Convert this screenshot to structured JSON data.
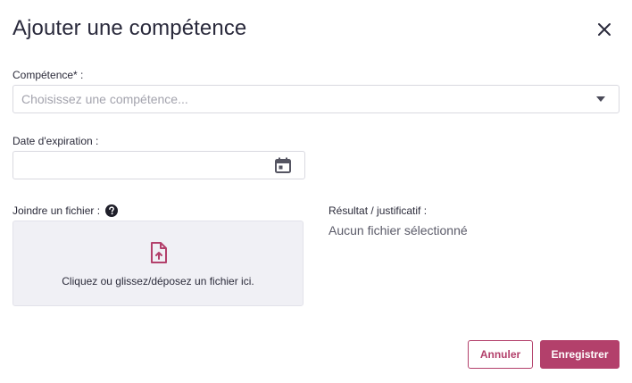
{
  "dialog": {
    "title": "Ajouter une compétence"
  },
  "form": {
    "skill": {
      "label": "Compétence* :",
      "placeholder": "Choisissez une compétence..."
    },
    "expiration": {
      "label": "Date d'expiration :",
      "value": ""
    },
    "attachment": {
      "label": "Joindre un fichier :",
      "dropzone_text": "Cliquez ou glissez/déposez un fichier ici."
    },
    "result": {
      "label": "Résultat / justificatif :",
      "value": "Aucun fichier sélectionné"
    }
  },
  "actions": {
    "cancel_label": "Annuler",
    "save_label": "Enregistrer"
  },
  "colors": {
    "accent": "#b3406b",
    "text": "#2b2b3a",
    "muted": "#a3a3ad",
    "dropzone_bg": "#f0f0f5"
  },
  "icons": {
    "close": "close-icon",
    "dropdown": "caret-down-icon",
    "calendar": "calendar-icon",
    "help": "help-circle-icon",
    "upload": "file-upload-icon"
  }
}
